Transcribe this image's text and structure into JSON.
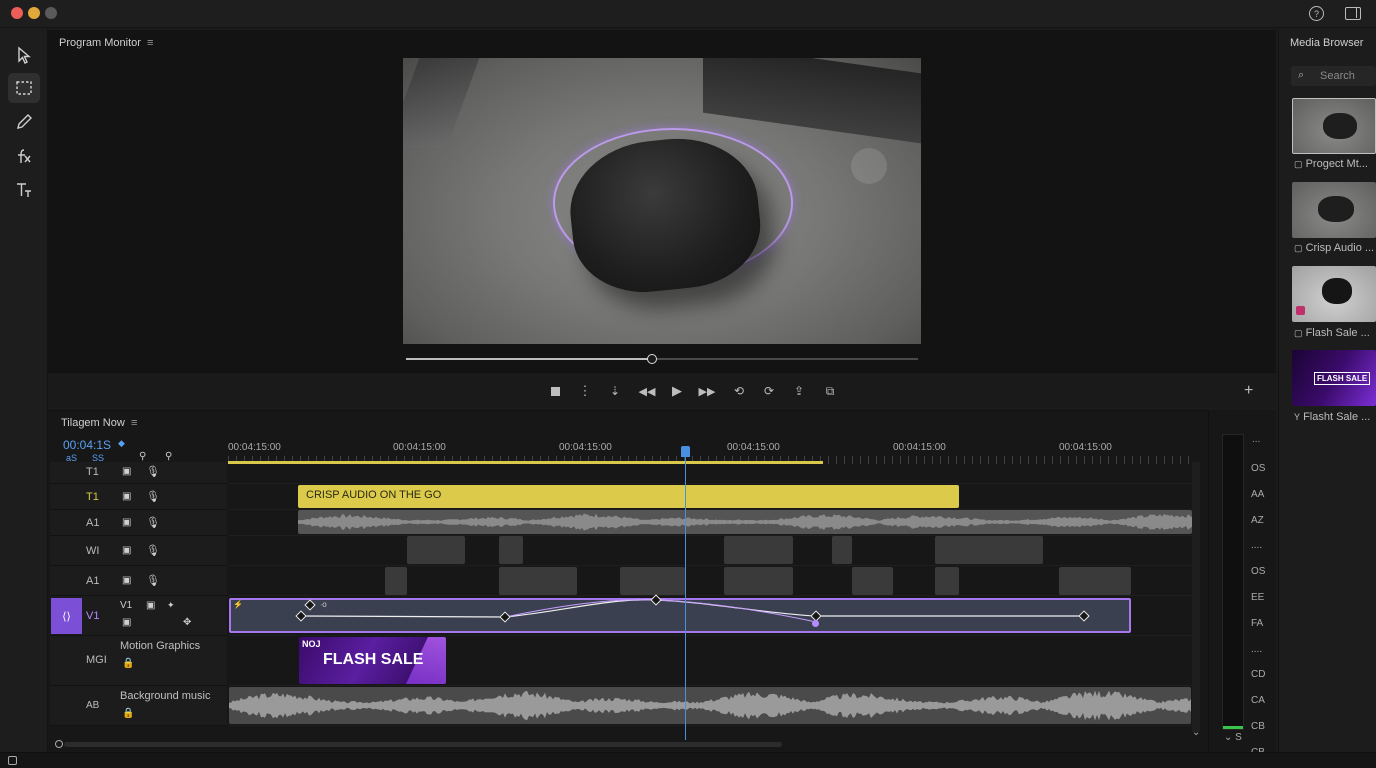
{
  "window": {
    "traffic_lights": [
      "#ec5e57",
      "#e1a93a",
      "#5a5a5a"
    ]
  },
  "program_monitor": {
    "title": "Program Monitor",
    "scrub_progress": 0.48,
    "transport_icons": [
      "stop-icon",
      "more-icon",
      "snap-icon",
      "step-back-icon",
      "play-icon",
      "step-forward-icon",
      "insert-icon",
      "overwrite-icon",
      "lift-icon",
      "export-frame-icon"
    ]
  },
  "timeline": {
    "title": "Tilagem Now",
    "timecode": "00:04:1S",
    "sub_labels": [
      "aS",
      "SS"
    ],
    "ruler_labels": [
      "00:04:15:00",
      "00:04:15:00",
      "00:04:15:00",
      "00:04:15:00",
      "00:04:15:00",
      "00:04:15:00"
    ],
    "tracks": [
      {
        "name": "T1"
      },
      {
        "name": "T1"
      },
      {
        "name": "A1"
      },
      {
        "name": "WI"
      },
      {
        "name": "A1"
      },
      {
        "name": "V1",
        "sub": "V1"
      },
      {
        "name": "MGI",
        "label": "Motion Graphics"
      },
      {
        "name": "AB",
        "label": "Background music"
      }
    ],
    "title_clip": "CRISP AUDIO ON THE GO",
    "flash_clip": {
      "badge": "NOJ",
      "text": "FLASH SALE"
    },
    "motion_keyframe_label": "∙o",
    "colors": {
      "accent": "#9b5cf6",
      "playhead": "#4a90e2",
      "title_clip": "#dccb4a"
    }
  },
  "audio_meter": {
    "labels": [
      "OS",
      "AA",
      "AZ",
      "....",
      "OS",
      "EE",
      "FA",
      "....",
      "CD",
      "CA",
      "CB",
      "CB"
    ],
    "footer": "S"
  },
  "media_browser": {
    "title": "Media Browser",
    "search_placeholder": "Search",
    "items": [
      {
        "label": "Progect Mt..."
      },
      {
        "label": "Crisp Audio ..."
      },
      {
        "label": "Flash Sale ..."
      },
      {
        "label": "Flasht Sale ...",
        "thumb_text": "FLASH SALE"
      }
    ]
  }
}
